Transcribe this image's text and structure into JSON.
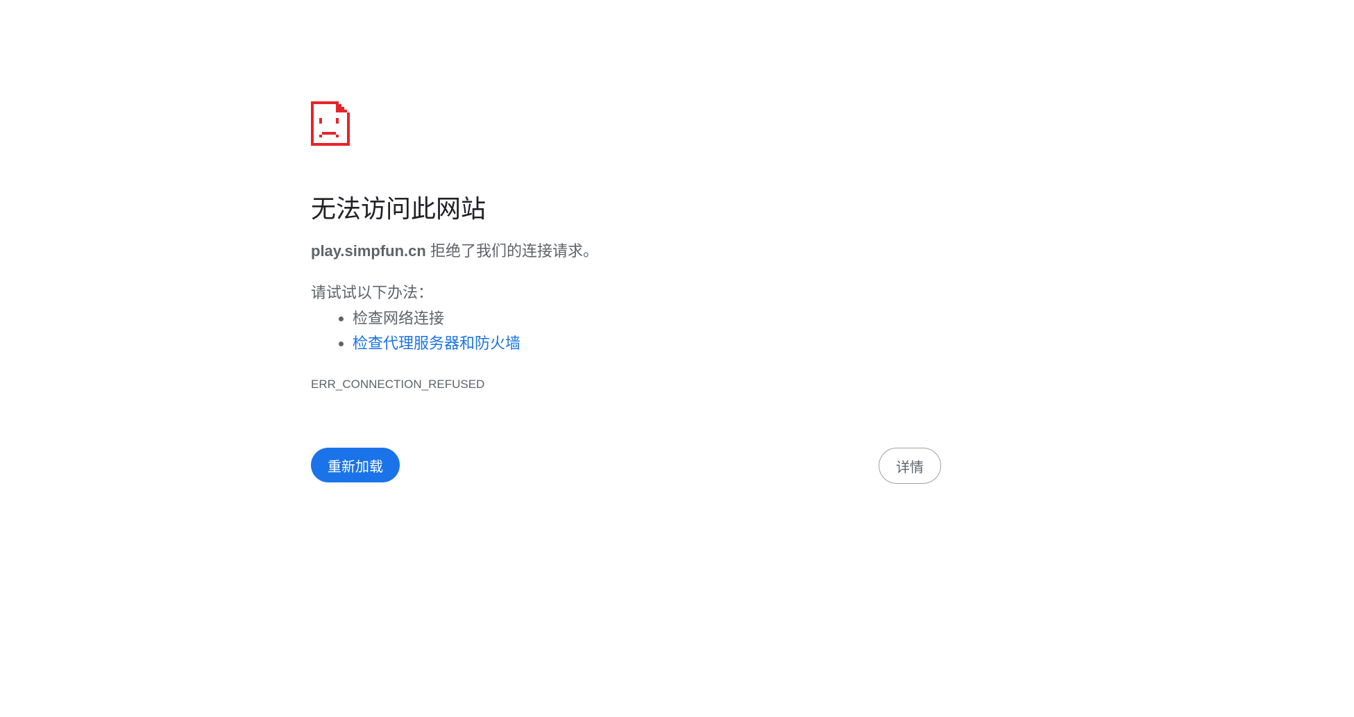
{
  "icon": {
    "name": "sad-page-icon",
    "color": "#e8222a"
  },
  "title": "无法访问此网站",
  "summary": {
    "host": "play.simpfun.cn",
    "message": "拒绝了我们的连接请求。"
  },
  "suggestions": {
    "heading": "请试试以下办法：",
    "items": [
      {
        "label": "检查网络连接",
        "link": false
      },
      {
        "label": "检查代理服务器和防火墙",
        "link": true
      }
    ]
  },
  "error_code": "ERR_CONNECTION_REFUSED",
  "buttons": {
    "reload_label": "重新加载",
    "details_label": "详情"
  },
  "colors": {
    "accent": "#1a73e8",
    "title_text": "#202124",
    "body_text": "#5f6368"
  }
}
